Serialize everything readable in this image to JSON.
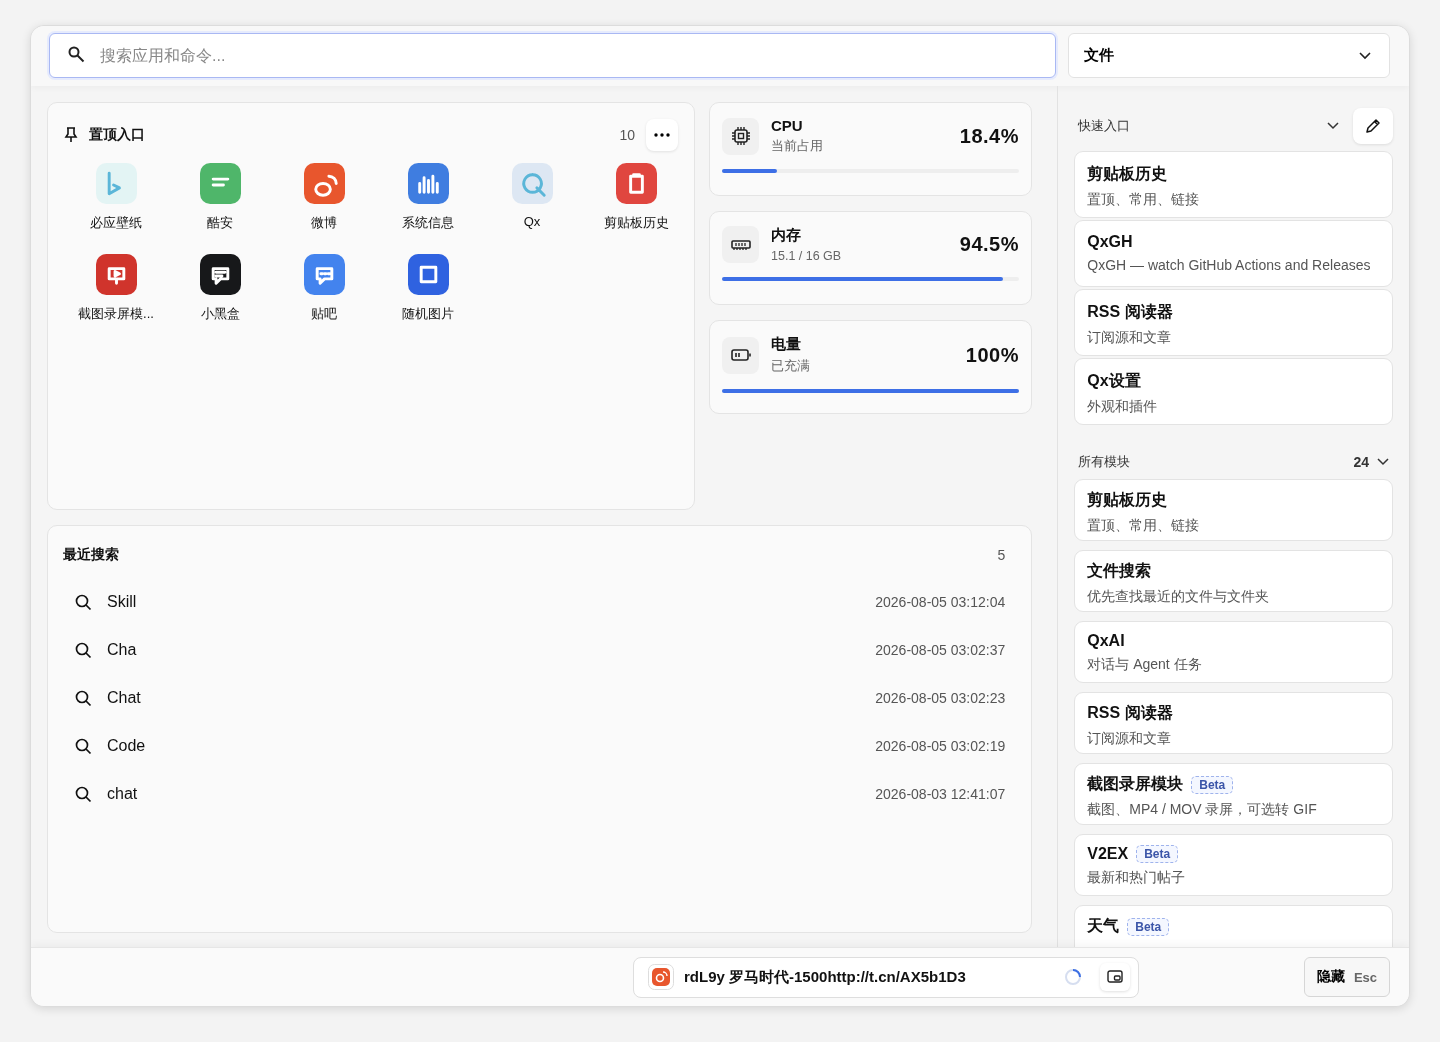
{
  "search": {
    "placeholder": "搜索应用和命令..."
  },
  "scope_dropdown": {
    "value": "文件"
  },
  "pinned": {
    "title": "置顶入口",
    "count": "10",
    "apps": [
      {
        "label": "必应壁纸",
        "color": "#e3f4f4"
      },
      {
        "label": "酷安",
        "color": "#4fb66a"
      },
      {
        "label": "微博",
        "color": "#e8562d"
      },
      {
        "label": "系统信息",
        "color": "#3f7de0"
      },
      {
        "label": "Qx",
        "color": "#dde7f3"
      },
      {
        "label": "剪贴板历史",
        "color": "#e0463f"
      },
      {
        "label": "截图录屏模...",
        "color": "#d0342c"
      },
      {
        "label": "小黑盒",
        "color": "#17181a"
      },
      {
        "label": "贴吧",
        "color": "#4383ee"
      },
      {
        "label": "随机图片",
        "color": "#2f62e0"
      }
    ]
  },
  "stats": [
    {
      "kind": "cpu",
      "title": "CPU",
      "subtitle": "当前占用",
      "value": "18.4%",
      "level": 0.184
    },
    {
      "kind": "memory",
      "title": "内存",
      "subtitle": "15.1 / 16 GB",
      "value": "94.5%",
      "level": 0.945
    },
    {
      "kind": "battery",
      "title": "电量",
      "subtitle": "已充满",
      "value": "100%",
      "level": 1.0
    }
  ],
  "recent": {
    "title": "最近搜索",
    "count": "5",
    "items": [
      {
        "query": "Skill",
        "time": "2026-08-05 03:12:04"
      },
      {
        "query": "Cha",
        "time": "2026-08-05 03:02:37"
      },
      {
        "query": "Chat",
        "time": "2026-08-05 03:02:23"
      },
      {
        "query": "Code",
        "time": "2026-08-05 03:02:19"
      },
      {
        "query": "chat",
        "time": "2026-08-03 12:41:07"
      }
    ]
  },
  "quick_access": {
    "title": "快速入口",
    "items": [
      {
        "title": "剪贴板历史",
        "description": "置顶、常用、链接"
      },
      {
        "title": "QxGH",
        "description": "QxGH — watch GitHub Actions and Releases"
      },
      {
        "title": "RSS 阅读器",
        "description": "订阅源和文章"
      },
      {
        "title": "Qx设置",
        "description": "外观和插件"
      }
    ]
  },
  "all_modules": {
    "title": "所有模块",
    "count": "24",
    "items": [
      {
        "title": "剪贴板历史",
        "description": "置顶、常用、链接"
      },
      {
        "title": "文件搜索",
        "description": "优先查找最近的文件与文件夹"
      },
      {
        "title": "QxAI",
        "description": "对话与 Agent 任务"
      },
      {
        "title": "RSS 阅读器",
        "description": "订阅源和文章"
      },
      {
        "title": "截图录屏模块",
        "description": "截图、MP4 / MOV 录屏，可选转 GIF",
        "badge": "Beta"
      },
      {
        "title": "V2EX",
        "description": "最新和热门帖子",
        "badge": "Beta"
      },
      {
        "title": "天气",
        "badge": "Beta"
      }
    ]
  },
  "now_playing": {
    "text": "rdL9y 罗马时代-1500http://t.cn/AX5b1D3"
  },
  "hide_button": {
    "label": "隐藏",
    "shortcut": "Esc"
  }
}
